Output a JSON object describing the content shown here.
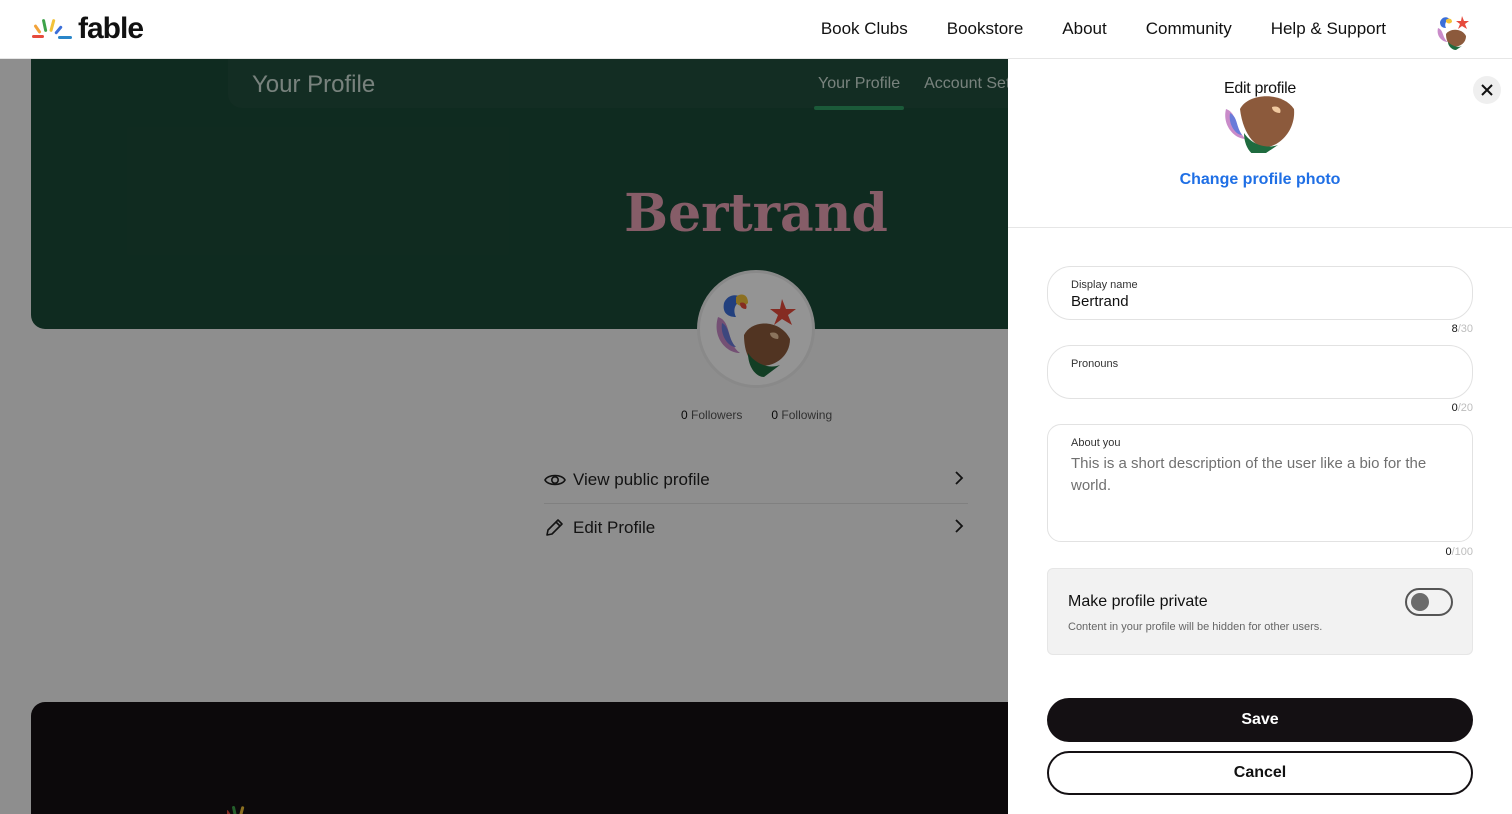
{
  "nav": {
    "logo_text": "fable",
    "links": [
      "Book Clubs",
      "Bookstore",
      "About",
      "Community",
      "Help & Support"
    ]
  },
  "profile_page": {
    "bar_title": "Your Profile",
    "tabs": [
      "Your Profile",
      "Account Set"
    ],
    "name": "Bertrand",
    "followers_count": "0",
    "followers_label": "Followers",
    "following_count": "0",
    "following_label": "Following",
    "menu": [
      {
        "label": "View public profile",
        "icon": "eye-icon"
      },
      {
        "label": "Edit Profile",
        "icon": "pencil-icon"
      }
    ]
  },
  "edit_panel": {
    "title": "Edit profile",
    "change_photo": "Change profile photo",
    "display_name": {
      "label": "Display name",
      "value": "Bertrand",
      "count": "8",
      "max": "/30"
    },
    "pronouns": {
      "label": "Pronouns",
      "value": "",
      "count": "0",
      "max": "/20"
    },
    "about": {
      "label": "About you",
      "placeholder": "This is a short description of the user like a bio for the world.",
      "count": "0",
      "max": "/100"
    },
    "private": {
      "title": "Make profile private",
      "description": "Content in your profile will be hidden for other users.",
      "enabled": false
    },
    "save_label": "Save",
    "cancel_label": "Cancel"
  },
  "colors": {
    "accent_link": "#1f6fe5",
    "hero_green": "#1b4a37",
    "name_pink": "#e7a0b3",
    "button_dark": "#141013"
  }
}
